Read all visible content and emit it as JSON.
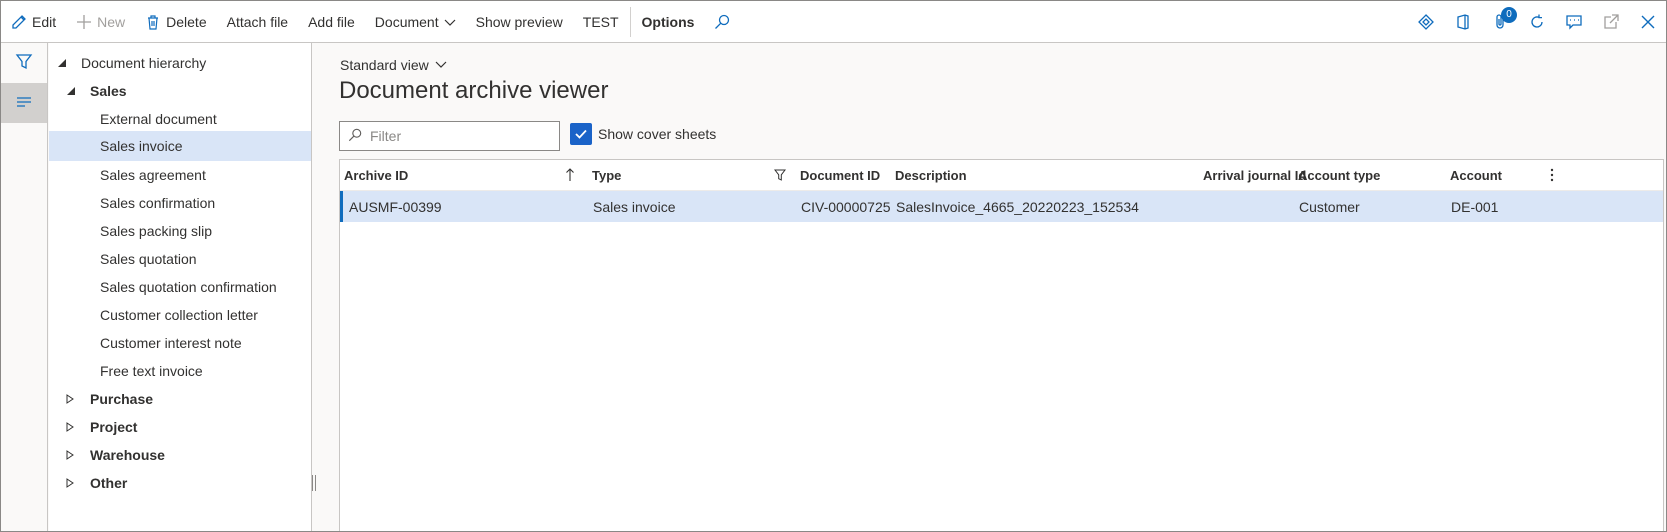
{
  "toolbar": {
    "edit": "Edit",
    "new": "New",
    "delete": "Delete",
    "attach_file": "Attach file",
    "add_file": "Add file",
    "document": "Document",
    "show_preview": "Show preview",
    "test": "TEST",
    "options": "Options",
    "notification_count": "0"
  },
  "tree": {
    "root": "Document hierarchy",
    "sales": "Sales",
    "sales_children": [
      "External document",
      "Sales invoice",
      "Sales agreement",
      "Sales confirmation",
      "Sales packing slip",
      "Sales quotation",
      "Sales quotation confirmation",
      "Customer collection letter",
      "Customer interest note",
      "Free text invoice"
    ],
    "selected": "Sales invoice",
    "groups": [
      "Purchase",
      "Project",
      "Warehouse",
      "Other"
    ]
  },
  "main": {
    "view": "Standard view",
    "title": "Document archive viewer",
    "filter_placeholder": "Filter",
    "show_cover_sheets": "Show cover sheets",
    "show_cover_sheets_checked": true
  },
  "grid": {
    "columns": [
      "Archive ID",
      "Type",
      "Document ID",
      "Description",
      "Arrival journal Id",
      "Account type",
      "Account"
    ],
    "rows": [
      {
        "archive_id": "AUSMF-00399",
        "type": "Sales invoice",
        "document_id": "CIV-00000725",
        "description": "SalesInvoice_4665_20220223_152534",
        "arrival_journal_id": "",
        "account_type": "Customer",
        "account": "DE-001"
      }
    ]
  },
  "colors": {
    "accent": "#0f6cbd",
    "selection": "#d9e5f7",
    "checkbox": "#1a63c8"
  }
}
